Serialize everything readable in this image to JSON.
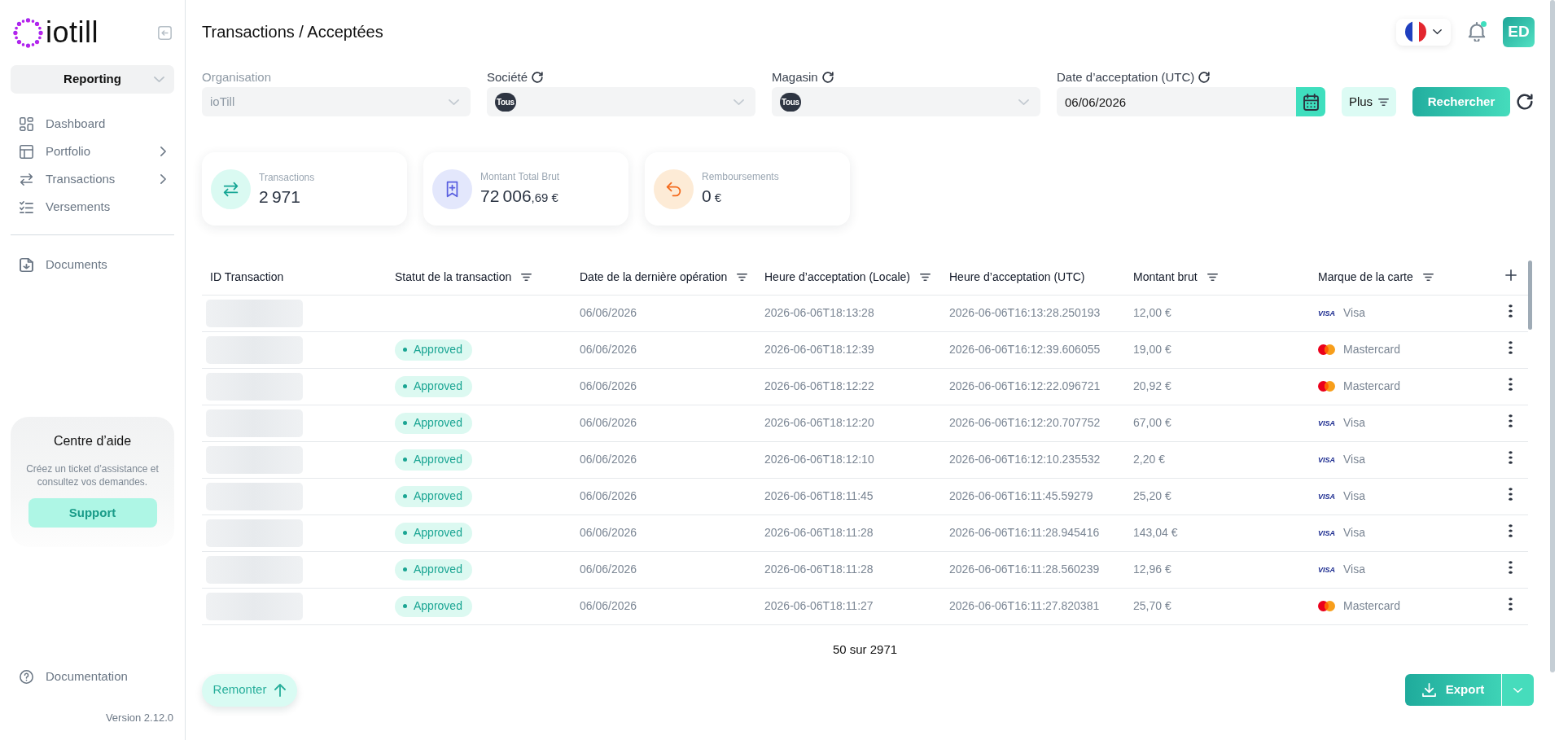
{
  "sidebar": {
    "logo": "iotill",
    "module": "Reporting",
    "nav": [
      {
        "kind": "dashboard",
        "label": "Dashboard",
        "has_submenu": false
      },
      {
        "kind": "portfolio",
        "label": "Portfolio",
        "has_submenu": true
      },
      {
        "kind": "transactions",
        "label": "Transactions",
        "has_submenu": true
      },
      {
        "kind": "payouts",
        "label": "Versements",
        "has_submenu": false
      }
    ],
    "secondary_nav": [
      {
        "kind": "documents",
        "label": "Documents",
        "has_submenu": false
      }
    ],
    "help_card": {
      "title": "Centre d’aide",
      "text": "Créez un ticket d’assistance et consultez vos demandes.",
      "button": "Support"
    },
    "footer_nav": [
      {
        "kind": "help",
        "label": "Documentation",
        "has_submenu": false
      }
    ],
    "version": "Version 2.12.0"
  },
  "header": {
    "breadcrumb": "Transactions / Acceptées",
    "notifications": {
      "unread": true
    },
    "avatar": "ED"
  },
  "filters": [
    {
      "kind": "select",
      "label": "Organisation",
      "value": "ioTill",
      "disabled": true,
      "resettable": false
    },
    {
      "kind": "select",
      "label": "Société",
      "chip": "Tous",
      "disabled": false,
      "resettable": true
    },
    {
      "kind": "select",
      "label": "Magasin",
      "chip": "Tous",
      "disabled": false,
      "resettable": true
    },
    {
      "kind": "date",
      "label": "Date d’acceptation (UTC)",
      "value": "06/06/2026",
      "disabled": false,
      "resettable": true
    }
  ],
  "filter_actions": {
    "more": "Plus",
    "search": "Rechercher"
  },
  "stats": [
    {
      "kind": "count",
      "label": "Transactions",
      "value": "2 971"
    },
    {
      "kind": "amount",
      "label": "Montant Total Brut",
      "value": "72 006",
      "decimals": ",69",
      "currency": "€"
    },
    {
      "kind": "refund",
      "label": "Remboursements",
      "value": "0",
      "currency": "€"
    }
  ],
  "table": {
    "columns": [
      {
        "label": "ID Transaction",
        "filterable": false
      },
      {
        "label": "Statut de la transaction",
        "filterable": true
      },
      {
        "label": "Date de la dernière opération",
        "filterable": true
      },
      {
        "label": "Heure d’acceptation (Locale)",
        "filterable": true
      },
      {
        "label": "Heure d’acceptation (UTC)",
        "filterable": false
      },
      {
        "label": "Montant brut",
        "filterable": true
      },
      {
        "label": "Marque de la carte",
        "filterable": true
      }
    ],
    "rows": [
      {
        "date": "06/06/2026",
        "local_time": "2026-06-06T18:13:28",
        "utc_time": "2026-06-06T16:13:28.250193",
        "amount": "12,00 €",
        "card": {
          "kind": "visa",
          "logo": "VISA",
          "brand": "Visa"
        }
      },
      {
        "status": "Approved",
        "date": "06/06/2026",
        "local_time": "2026-06-06T18:12:39",
        "utc_time": "2026-06-06T16:12:39.606055",
        "amount": "19,00 €",
        "card": {
          "kind": "mastercard",
          "brand": "Mastercard"
        }
      },
      {
        "status": "Approved",
        "date": "06/06/2026",
        "local_time": "2026-06-06T18:12:22",
        "utc_time": "2026-06-06T16:12:22.096721",
        "amount": "20,92 €",
        "card": {
          "kind": "mastercard",
          "brand": "Mastercard"
        }
      },
      {
        "status": "Approved",
        "date": "06/06/2026",
        "local_time": "2026-06-06T18:12:20",
        "utc_time": "2026-06-06T16:12:20.707752",
        "amount": "67,00 €",
        "card": {
          "kind": "visa",
          "logo": "VISA",
          "brand": "Visa"
        }
      },
      {
        "status": "Approved",
        "date": "06/06/2026",
        "local_time": "2026-06-06T18:12:10",
        "utc_time": "2026-06-06T16:12:10.235532",
        "amount": "2,20 €",
        "card": {
          "kind": "visa",
          "logo": "VISA",
          "brand": "Visa"
        }
      },
      {
        "status": "Approved",
        "date": "06/06/2026",
        "local_time": "2026-06-06T18:11:45",
        "utc_time": "2026-06-06T16:11:45.59279",
        "amount": "25,20 €",
        "card": {
          "kind": "visa",
          "logo": "VISA",
          "brand": "Visa"
        }
      },
      {
        "status": "Approved",
        "date": "06/06/2026",
        "local_time": "2026-06-06T18:11:28",
        "utc_time": "2026-06-06T16:11:28.945416",
        "amount": "143,04 €",
        "card": {
          "kind": "visa",
          "logo": "VISA",
          "brand": "Visa"
        }
      },
      {
        "status": "Approved",
        "date": "06/06/2026",
        "local_time": "2026-06-06T18:11:28",
        "utc_time": "2026-06-06T16:11:28.560239",
        "amount": "12,96 €",
        "card": {
          "kind": "visa",
          "logo": "VISA",
          "brand": "Visa"
        }
      },
      {
        "status": "Approved",
        "date": "06/06/2026",
        "local_time": "2026-06-06T18:11:27",
        "utc_time": "2026-06-06T16:11:27.820381",
        "amount": "25,70 €",
        "card": {
          "kind": "mastercard",
          "brand": "Mastercard"
        }
      }
    ]
  },
  "pagination": "50 sur 2971",
  "actions": {
    "back_to_top": "Remonter",
    "export": "Export"
  }
}
